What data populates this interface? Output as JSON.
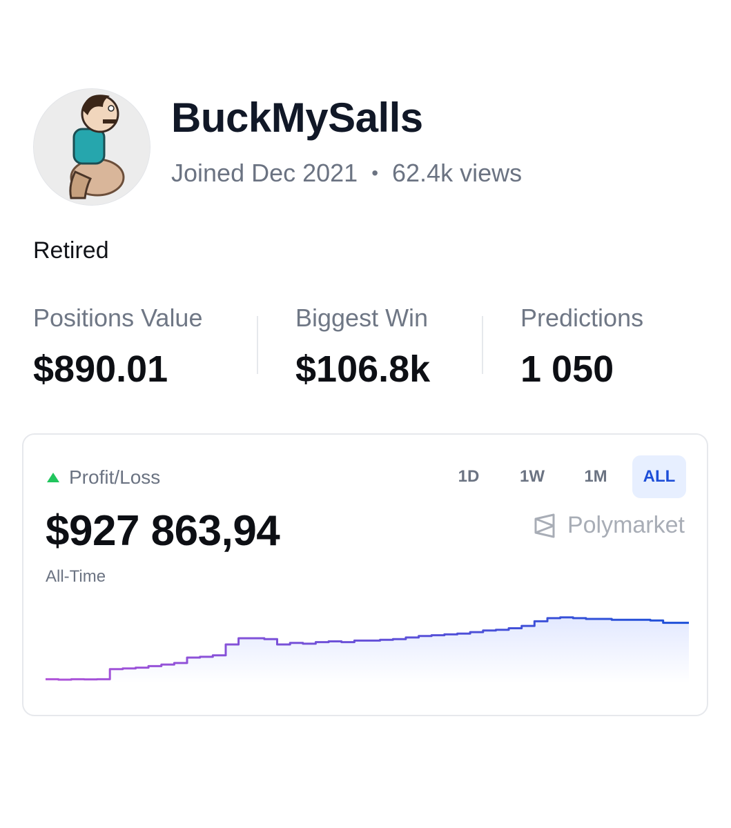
{
  "profile": {
    "username": "BuckMySalls",
    "joined": "Joined Dec 2021",
    "separator": "•",
    "views": "62.4k views",
    "bio": "Retired",
    "avatar_icon": "avatar-cartoon-icon"
  },
  "stats": [
    {
      "label": "Positions Value",
      "value": "$890.01"
    },
    {
      "label": "Biggest Win",
      "value": "$106.8k"
    },
    {
      "label": "Predictions",
      "value": "1 050"
    }
  ],
  "pnl": {
    "label": "Profit/Loss",
    "value": "$927 863,94",
    "sublabel": "All-Time",
    "trend_icon": "triangle-up-icon",
    "trend_color": "#21c55d",
    "ranges": [
      "1D",
      "1W",
      "1M",
      "ALL"
    ],
    "active_range": "ALL",
    "brand": "Polymarket",
    "brand_icon": "polymarket-logo-icon"
  },
  "chart_data": {
    "type": "area",
    "x": [
      0,
      1,
      2,
      3,
      4,
      5,
      6,
      7,
      8,
      9,
      10,
      11,
      12,
      13,
      14,
      15,
      16,
      17,
      18,
      19,
      20,
      21,
      22,
      23,
      24,
      25,
      26,
      27,
      28,
      29,
      30,
      31,
      32,
      33,
      34,
      35,
      36,
      37,
      38,
      39,
      40,
      41,
      42,
      43,
      44,
      45,
      46,
      47,
      48,
      49,
      50
    ],
    "values": [
      5,
      4.5,
      5,
      4.8,
      5,
      18,
      19,
      20,
      22,
      24,
      26,
      33,
      34,
      36,
      50,
      58,
      58,
      57,
      50,
      52,
      51,
      53,
      54,
      53,
      55,
      55,
      56,
      57,
      59,
      61,
      62,
      63,
      64,
      66,
      68,
      69,
      71,
      74,
      80,
      84,
      85,
      84,
      83,
      83,
      82,
      82,
      82,
      81,
      78,
      78,
      78
    ],
    "ylim": [
      0,
      100
    ],
    "line_color_start": "#b052d8",
    "line_color_end": "#1a4fd8",
    "fill_color": "#dfe6ff",
    "grid": false
  }
}
